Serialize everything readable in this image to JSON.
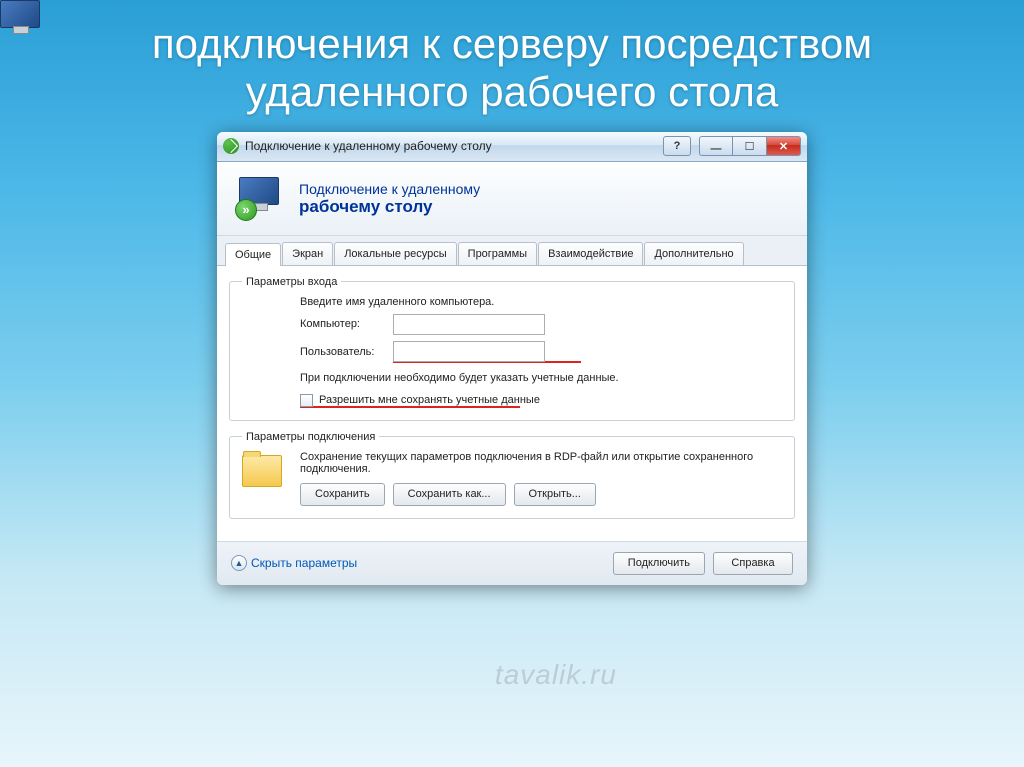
{
  "slide": {
    "title": "подключения к серверу посредством удаленного рабочего стола"
  },
  "window": {
    "title": "Подключение к удаленному рабочему столу",
    "header": {
      "line1": "Подключение к удаленному",
      "line2": "рабочему столу"
    },
    "tabs": [
      "Общие",
      "Экран",
      "Локальные ресурсы",
      "Программы",
      "Взаимодействие",
      "Дополнительно"
    ],
    "login_group": {
      "legend": "Параметры входа",
      "intro": "Введите имя удаленного компьютера.",
      "computer_label": "Компьютер:",
      "computer_value": "",
      "user_label": "Пользователь:",
      "user_value": "",
      "hint": "При подключении необходимо будет указать учетные данные.",
      "checkbox_label": "Разрешить мне сохранять учетные данные"
    },
    "conn_group": {
      "legend": "Параметры подключения",
      "text": "Сохранение текущих параметров подключения в RDP-файл или открытие сохраненного подключения.",
      "save": "Сохранить",
      "save_as": "Сохранить как...",
      "open": "Открыть..."
    },
    "footer": {
      "collapse": "Скрыть параметры",
      "connect": "Подключить",
      "help": "Справка"
    }
  },
  "watermark": "tavalik.ru"
}
